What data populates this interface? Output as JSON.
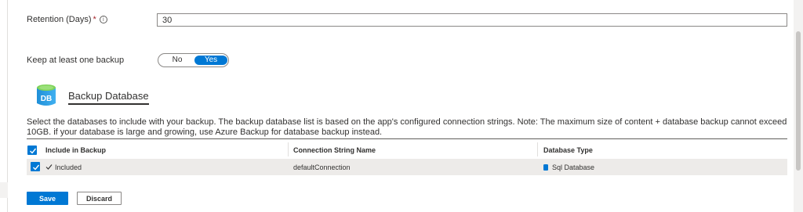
{
  "retention": {
    "label": "Retention (Days)",
    "required_mark": "*",
    "info_glyph": "i",
    "value": "30"
  },
  "keep_backup": {
    "label": "Keep at least one backup",
    "options": [
      "No",
      "Yes"
    ],
    "selected": "Yes"
  },
  "section": {
    "icon_text": "DB",
    "title": "Backup Database",
    "description": "Select the databases to include with your backup. The backup database list is based on the app's configured connection strings. Note: The maximum size of content + database backup cannot exceed 10GB. if your database is large and growing, use Azure Backup for database backup instead."
  },
  "grid": {
    "columns": [
      "Include in Backup",
      "Connection String Name",
      "Database Type"
    ],
    "rows": [
      {
        "include": "Included",
        "connection": "defaultConnection",
        "type": "Sql Database"
      }
    ]
  },
  "footer": {
    "save_label": "Save",
    "discard_label": "Discard"
  },
  "colors": {
    "accent": "#0078d4",
    "row_selected": "#edebe9",
    "required": "#a4262c"
  },
  "icons": [
    "info-icon",
    "database-icon",
    "checkmark-icon",
    "sql-database-icon"
  ]
}
